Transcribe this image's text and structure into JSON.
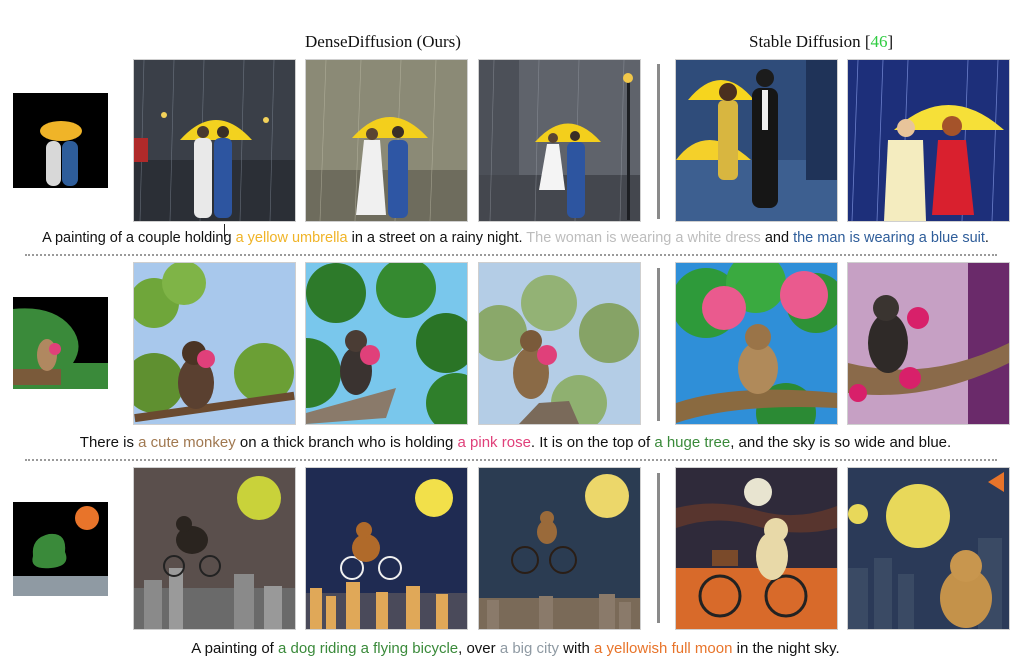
{
  "header": {
    "left_title": "DenseDiffusion (Ours)",
    "right_title_prefix": "Stable Diffusion [",
    "right_ref": "46",
    "right_title_suffix": "]"
  },
  "colors": {
    "yellow": "#f0b428",
    "light_gray": "#bdbdbd",
    "blue": "#2e5d9a",
    "brown": "#a07850",
    "pink": "#e0407a",
    "green": "#3a8a3a",
    "gray": "#8f9aa3",
    "orange": "#e8742a"
  },
  "rows": [
    {
      "caption": [
        {
          "text": "A painting of a couple holding ",
          "color": ""
        },
        {
          "text": "a yellow umbrella",
          "color": "yellow"
        },
        {
          "text": " in a street on a rainy night. ",
          "color": ""
        },
        {
          "text": "The woman is wearing a white dress",
          "color": "light_gray"
        },
        {
          "text": " and ",
          "color": ""
        },
        {
          "text": "the man is wearing a blue suit",
          "color": "blue"
        },
        {
          "text": ".",
          "color": ""
        }
      ]
    },
    {
      "caption": [
        {
          "text": "There is ",
          "color": ""
        },
        {
          "text": "a cute monkey",
          "color": "brown"
        },
        {
          "text": " on a thick branch",
          "color": ""
        },
        {
          "text": " who is holding ",
          "color": ""
        },
        {
          "text": "a pink rose",
          "color": "pink"
        },
        {
          "text": ". It is on the top of ",
          "color": ""
        },
        {
          "text": "a huge tree",
          "color": "green"
        },
        {
          "text": ", and the sky is so wide and blue.",
          "color": ""
        }
      ]
    },
    {
      "caption": [
        {
          "text": "A painting of ",
          "color": ""
        },
        {
          "text": "a dog riding a flying bicycle",
          "color": "green"
        },
        {
          "text": ", over ",
          "color": ""
        },
        {
          "text": "a big city",
          "color": "gray"
        },
        {
          "text": " with ",
          "color": ""
        },
        {
          "text": "a yellowish full moon",
          "color": "orange"
        },
        {
          "text": " in the night sky.",
          "color": ""
        }
      ]
    }
  ]
}
